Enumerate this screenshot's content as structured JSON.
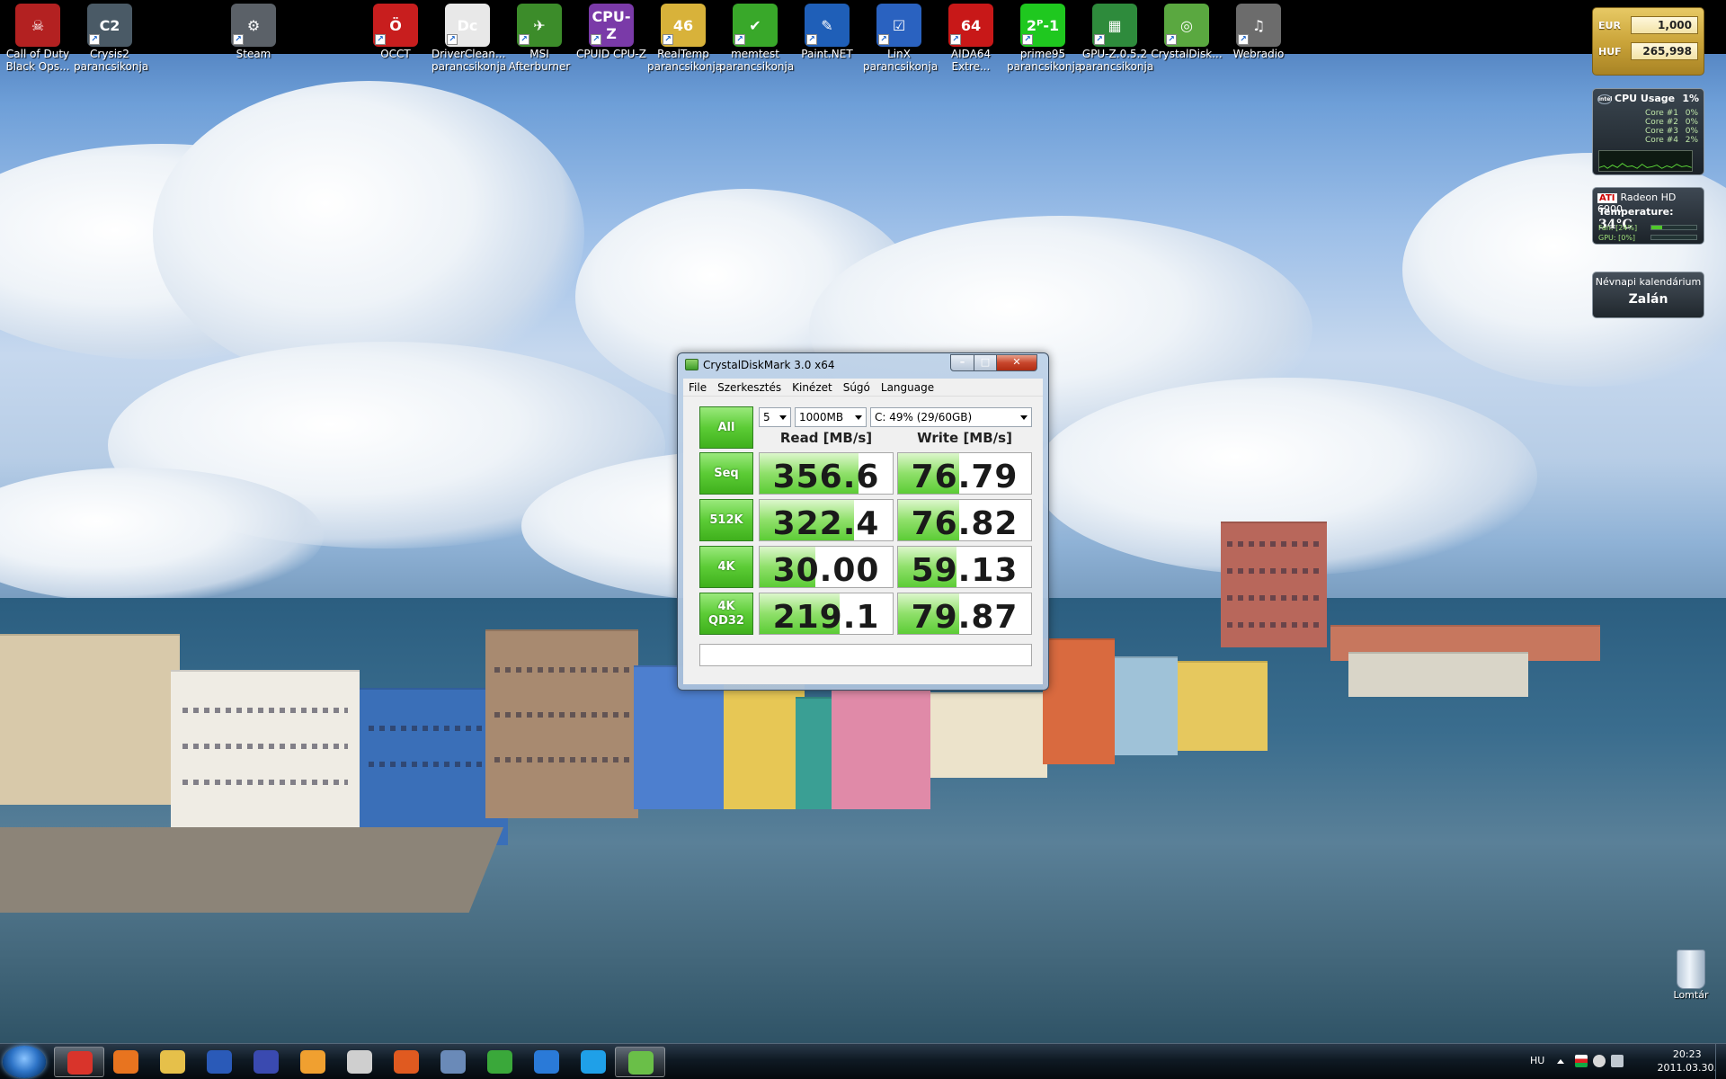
{
  "desktop_icons": [
    {
      "label": "Call of Duty\nBlack Ops...",
      "color": "#b32121",
      "glyph": "☠",
      "shortcut": false
    },
    {
      "label": "Crysis2\nparancsikonja",
      "color": "#4a5a66",
      "glyph": "C2",
      "shortcut": true
    },
    {
      "label": "Steam",
      "color": "#5b6168",
      "glyph": "⚙",
      "shortcut": true
    },
    {
      "label": "OCCT",
      "color": "#c81e1e",
      "glyph": "Ö",
      "shortcut": true
    },
    {
      "label": "DriverClean...\nparancsikonja",
      "color": "#e8e8e8",
      "glyph": "Dc",
      "shortcut": true
    },
    {
      "label": "MSI\nAfterburner",
      "color": "#3c8c2a",
      "glyph": "✈",
      "shortcut": true
    },
    {
      "label": "CPUID CPU-Z",
      "color": "#7a3aa8",
      "glyph": "CPU-Z",
      "shortcut": true
    },
    {
      "label": "RealTemp\nparancsikonja",
      "color": "#d8b23a",
      "glyph": "46",
      "shortcut": true
    },
    {
      "label": "memtest\nparancsikonja",
      "color": "#39a82a",
      "glyph": "✔",
      "shortcut": true
    },
    {
      "label": "Paint.NET",
      "color": "#1f5fb8",
      "glyph": "✎",
      "shortcut": true
    },
    {
      "label": "LinX\nparancsikonja",
      "color": "#2a62c0",
      "glyph": "☑",
      "shortcut": true
    },
    {
      "label": "AIDA64\nExtre...",
      "color": "#c81818",
      "glyph": "64",
      "shortcut": true
    },
    {
      "label": "prime95\nparancsikonja",
      "color": "#1fc81f",
      "glyph": "2ᴾ-1",
      "shortcut": true
    },
    {
      "label": "GPU-Z.0.5.2\nparancsikonja",
      "color": "#2e8b3c",
      "glyph": "▦",
      "shortcut": true
    },
    {
      "label": "CrystalDisk...",
      "color": "#5aa840",
      "glyph": "◎",
      "shortcut": true
    },
    {
      "label": "Webradio",
      "color": "#6c6c6c",
      "glyph": "♫",
      "shortcut": true
    }
  ],
  "gadgets": {
    "currency": [
      {
        "code": "EUR",
        "value": "1,000"
      },
      {
        "code": "HUF",
        "value": "265,998"
      }
    ],
    "cpu": {
      "title": "CPU Usage",
      "total": "1%",
      "badge": "intel",
      "cores": [
        {
          "name": "Core #1",
          "value": "0%"
        },
        {
          "name": "Core #2",
          "value": "0%"
        },
        {
          "name": "Core #3",
          "value": "0%"
        },
        {
          "name": "Core #4",
          "value": "2%"
        }
      ]
    },
    "gpu": {
      "brand": "ATI",
      "name": "Radeon HD 6900",
      "temp_label": "Temperature:",
      "temp_value": "34°C",
      "fan": "Fan: [24%]",
      "fan_level": 0.24,
      "gpu_load": "GPU: [0%]",
      "gpu_level": 0.0
    },
    "nameday": {
      "title": "Névnapi kalendárium",
      "name": "Zalán"
    }
  },
  "recycle_bin": {
    "label": "Lomtár"
  },
  "cdm": {
    "title": "CrystalDiskMark 3.0 x64",
    "controls": {
      "min": "–",
      "max": "□",
      "close": "✕"
    },
    "menu": [
      "File",
      "Szerkesztés",
      "Kinézet",
      "Súgó",
      "Language"
    ],
    "all_button": "All",
    "runs": "5",
    "size": "1000MB",
    "drive": "C: 49% (29/60GB)",
    "read_header": "Read [MB/s]",
    "write_header": "Write [MB/s]",
    "rows": [
      {
        "label": "Seq",
        "read": "356.6",
        "write": "76.79",
        "read_fill": 0.74,
        "write_fill": 0.46
      },
      {
        "label": "512K",
        "read": "322.4",
        "write": "76.82",
        "read_fill": 0.71,
        "write_fill": 0.46
      },
      {
        "label": "4K",
        "read": "30.00",
        "write": "59.13",
        "read_fill": 0.42,
        "write_fill": 0.44
      },
      {
        "label": "4K\nQD32",
        "read": "219.1",
        "write": "79.87",
        "read_fill": 0.6,
        "write_fill": 0.46
      }
    ],
    "comment": ""
  },
  "taskbar": {
    "apps": [
      {
        "name": "Chrome",
        "color": "#d9342b",
        "active": true
      },
      {
        "name": "Firefox",
        "color": "#e8741f",
        "active": false
      },
      {
        "name": "Explorer",
        "color": "#e6c04a",
        "active": false
      },
      {
        "name": "Word",
        "color": "#2a5ab8",
        "active": false
      },
      {
        "name": "Save",
        "color": "#3a4ab0",
        "active": false
      },
      {
        "name": "Media Player",
        "color": "#f0a030",
        "active": false
      },
      {
        "name": "Movie Maker",
        "color": "#cfcfcf",
        "active": false
      },
      {
        "name": "Paint",
        "color": "#e05a20",
        "active": false
      },
      {
        "name": "Viewer",
        "color": "#6a8ab8",
        "active": false
      },
      {
        "name": "uTorrent",
        "color": "#3aa83a",
        "active": false
      },
      {
        "name": "Speed Tool",
        "color": "#2a7ad8",
        "active": false
      },
      {
        "name": "Skype",
        "color": "#1fa0e8",
        "active": false
      },
      {
        "name": "CrystalDiskMark",
        "color": "#6abf48",
        "active": true
      }
    ],
    "tray": {
      "language": "HU",
      "time": "20:23",
      "date": "2011.03.30."
    }
  }
}
